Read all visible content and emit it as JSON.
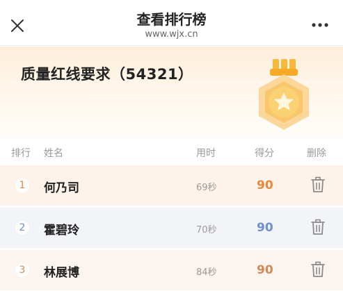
{
  "nav": {
    "title": "查看排行榜",
    "url": "www.wjx.cn",
    "close_icon": "close-icon",
    "more_icon": "more-dots-icon"
  },
  "banner": {
    "title": "质量红线要求（54321）",
    "medal_icon": "star-medal-icon"
  },
  "table": {
    "headers": {
      "rank": "排行",
      "name": "姓名",
      "time": "用时",
      "score": "得分",
      "delete": "删除"
    },
    "rows": [
      {
        "rank": "1",
        "name": "何乃司",
        "time": "69秒",
        "score": "90",
        "rank_color": "#e8873c"
      },
      {
        "rank": "2",
        "name": "霍碧玲",
        "time": "70秒",
        "score": "90",
        "rank_color": "#6b8fd0"
      },
      {
        "rank": "3",
        "name": "林展博",
        "time": "84秒",
        "score": "90",
        "rank_color": "#d08a55"
      }
    ],
    "delete_icon": "trash-icon"
  }
}
